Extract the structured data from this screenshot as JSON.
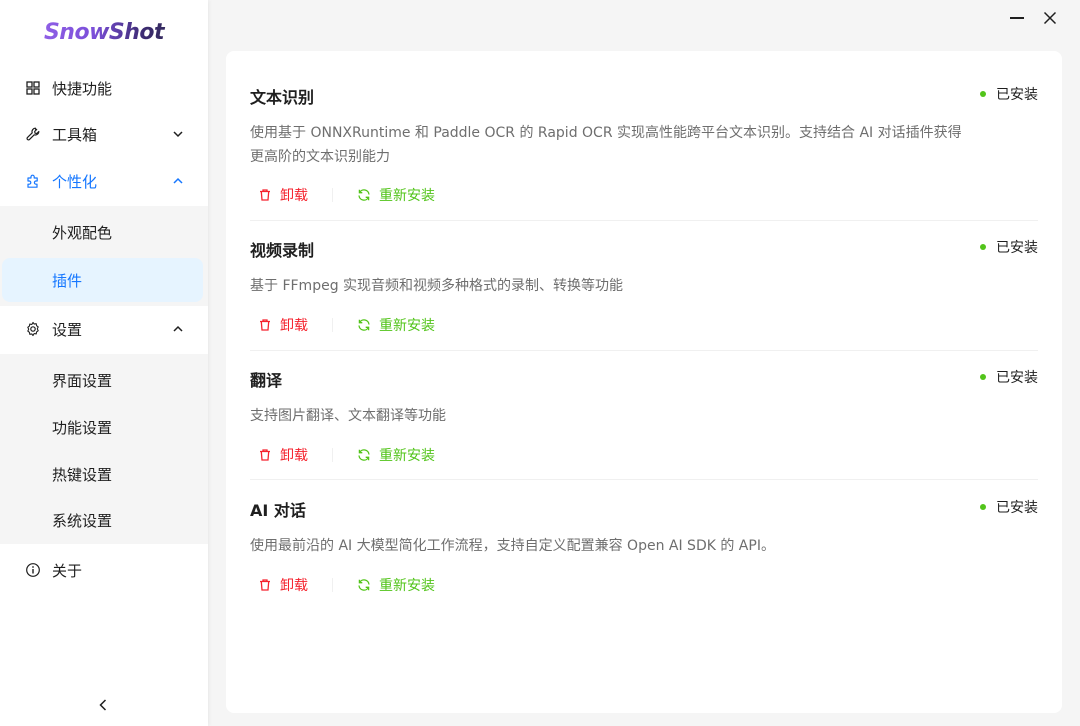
{
  "app": {
    "logo": "SnowShot"
  },
  "sidebar": {
    "items": [
      {
        "label": "快捷功能",
        "icon": "grid-icon"
      },
      {
        "label": "工具箱",
        "icon": "wrench-icon"
      },
      {
        "label": "个性化",
        "icon": "puzzle-icon"
      },
      {
        "label": "设置",
        "icon": "gear-icon"
      },
      {
        "label": "关于",
        "icon": "info-icon"
      }
    ],
    "personalize_sub": [
      {
        "label": "外观配色"
      },
      {
        "label": "插件"
      }
    ],
    "settings_sub": [
      {
        "label": "界面设置"
      },
      {
        "label": "功能设置"
      },
      {
        "label": "热键设置"
      },
      {
        "label": "系统设置"
      }
    ]
  },
  "plugins": [
    {
      "title": "文本识别",
      "status": "已安装",
      "desc": "使用基于 ONNXRuntime 和 Paddle OCR 的 Rapid OCR 实现高性能跨平台文本识别。支持结合 AI 对话插件获得更高阶的文本识别能力",
      "uninstall": "卸载",
      "reinstall": "重新安装"
    },
    {
      "title": "视频录制",
      "status": "已安装",
      "desc": "基于 FFmpeg 实现音频和视频多种格式的录制、转换等功能",
      "uninstall": "卸载",
      "reinstall": "重新安装"
    },
    {
      "title": "翻译",
      "status": "已安装",
      "desc": "支持图片翻译、文本翻译等功能",
      "uninstall": "卸载",
      "reinstall": "重新安装"
    },
    {
      "title": "AI 对话",
      "status": "已安装",
      "desc": "使用最前沿的 AI 大模型简化工作流程，支持自定义配置兼容 Open AI SDK 的 API。",
      "uninstall": "卸载",
      "reinstall": "重新安装"
    }
  ],
  "colors": {
    "primary": "#1677ff",
    "success": "#52c41a",
    "danger": "#f5222d"
  }
}
